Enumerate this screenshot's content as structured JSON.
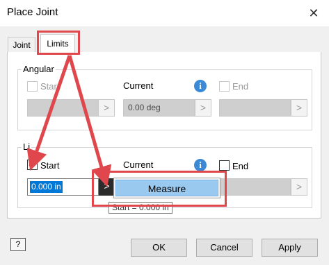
{
  "window": {
    "title": "Place Joint",
    "close_glyph": "✕"
  },
  "tabs": [
    {
      "label": "Joint"
    },
    {
      "label": "Limits"
    }
  ],
  "angular": {
    "group_label": "Angular",
    "start_label": "Start",
    "current_label": "Current",
    "end_label": "End",
    "current_value": "0.00 deg",
    "btn_glyph": ">"
  },
  "linear": {
    "group_label": "Li",
    "start_label": "Start",
    "current_label": "Current",
    "end_label": "End",
    "start_value": "0.000 in",
    "btn_glyph": ">",
    "start_checked": true
  },
  "menu": {
    "measure_label": "Measure"
  },
  "tooltip": {
    "text": "Start = 0.000 in"
  },
  "footer": {
    "help_glyph": "?",
    "ok_label": "OK",
    "cancel_label": "Cancel",
    "apply_label": "Apply"
  },
  "info_glyph": "i",
  "colors": {
    "annotation_red": "#e0474c",
    "info_blue": "#3b8ad8",
    "menu_highlight": "#99c9ef",
    "selection_blue": "#0078d7"
  }
}
